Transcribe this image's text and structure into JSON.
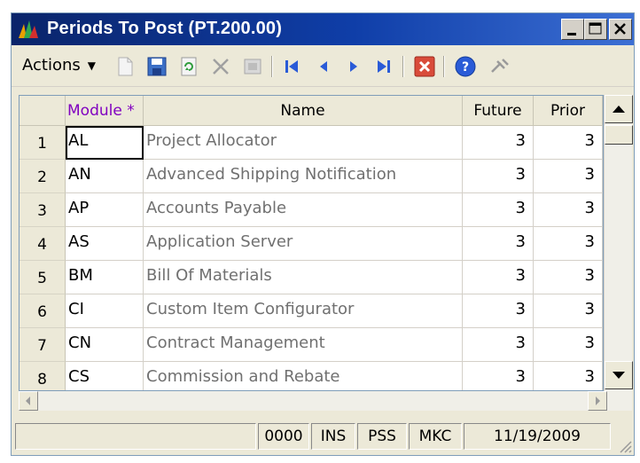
{
  "window": {
    "title": "Periods To Post (PT.200.00)"
  },
  "toolbar": {
    "actions_label": "Actions"
  },
  "grid": {
    "columns": [
      "Module *",
      "Name",
      "Future",
      "Prior"
    ],
    "rows": [
      {
        "num": "1",
        "module": "AL",
        "name": "Project Allocator",
        "future": "3",
        "prior": "3"
      },
      {
        "num": "2",
        "module": "AN",
        "name": "Advanced Shipping Notification",
        "future": "3",
        "prior": "3"
      },
      {
        "num": "3",
        "module": "AP",
        "name": "Accounts Payable",
        "future": "3",
        "prior": "3"
      },
      {
        "num": "4",
        "module": "AS",
        "name": "Application Server",
        "future": "3",
        "prior": "3"
      },
      {
        "num": "5",
        "module": "BM",
        "name": "Bill Of Materials",
        "future": "3",
        "prior": "3"
      },
      {
        "num": "6",
        "module": "CI",
        "name": "Custom Item Configurator",
        "future": "3",
        "prior": "3"
      },
      {
        "num": "7",
        "module": "CN",
        "name": "Contract Management",
        "future": "3",
        "prior": "3"
      },
      {
        "num": "8",
        "module": "CS",
        "name": "Commission and Rebate",
        "future": "3",
        "prior": "3"
      }
    ]
  },
  "status": {
    "panel1": "0000",
    "panel2": "INS",
    "panel3": "PSS",
    "panel4": "MKC",
    "date": "11/19/2009"
  },
  "colors": {
    "title_bar": "#0a246a",
    "module_header": "#8000c0",
    "chrome": "#ece9d8"
  }
}
